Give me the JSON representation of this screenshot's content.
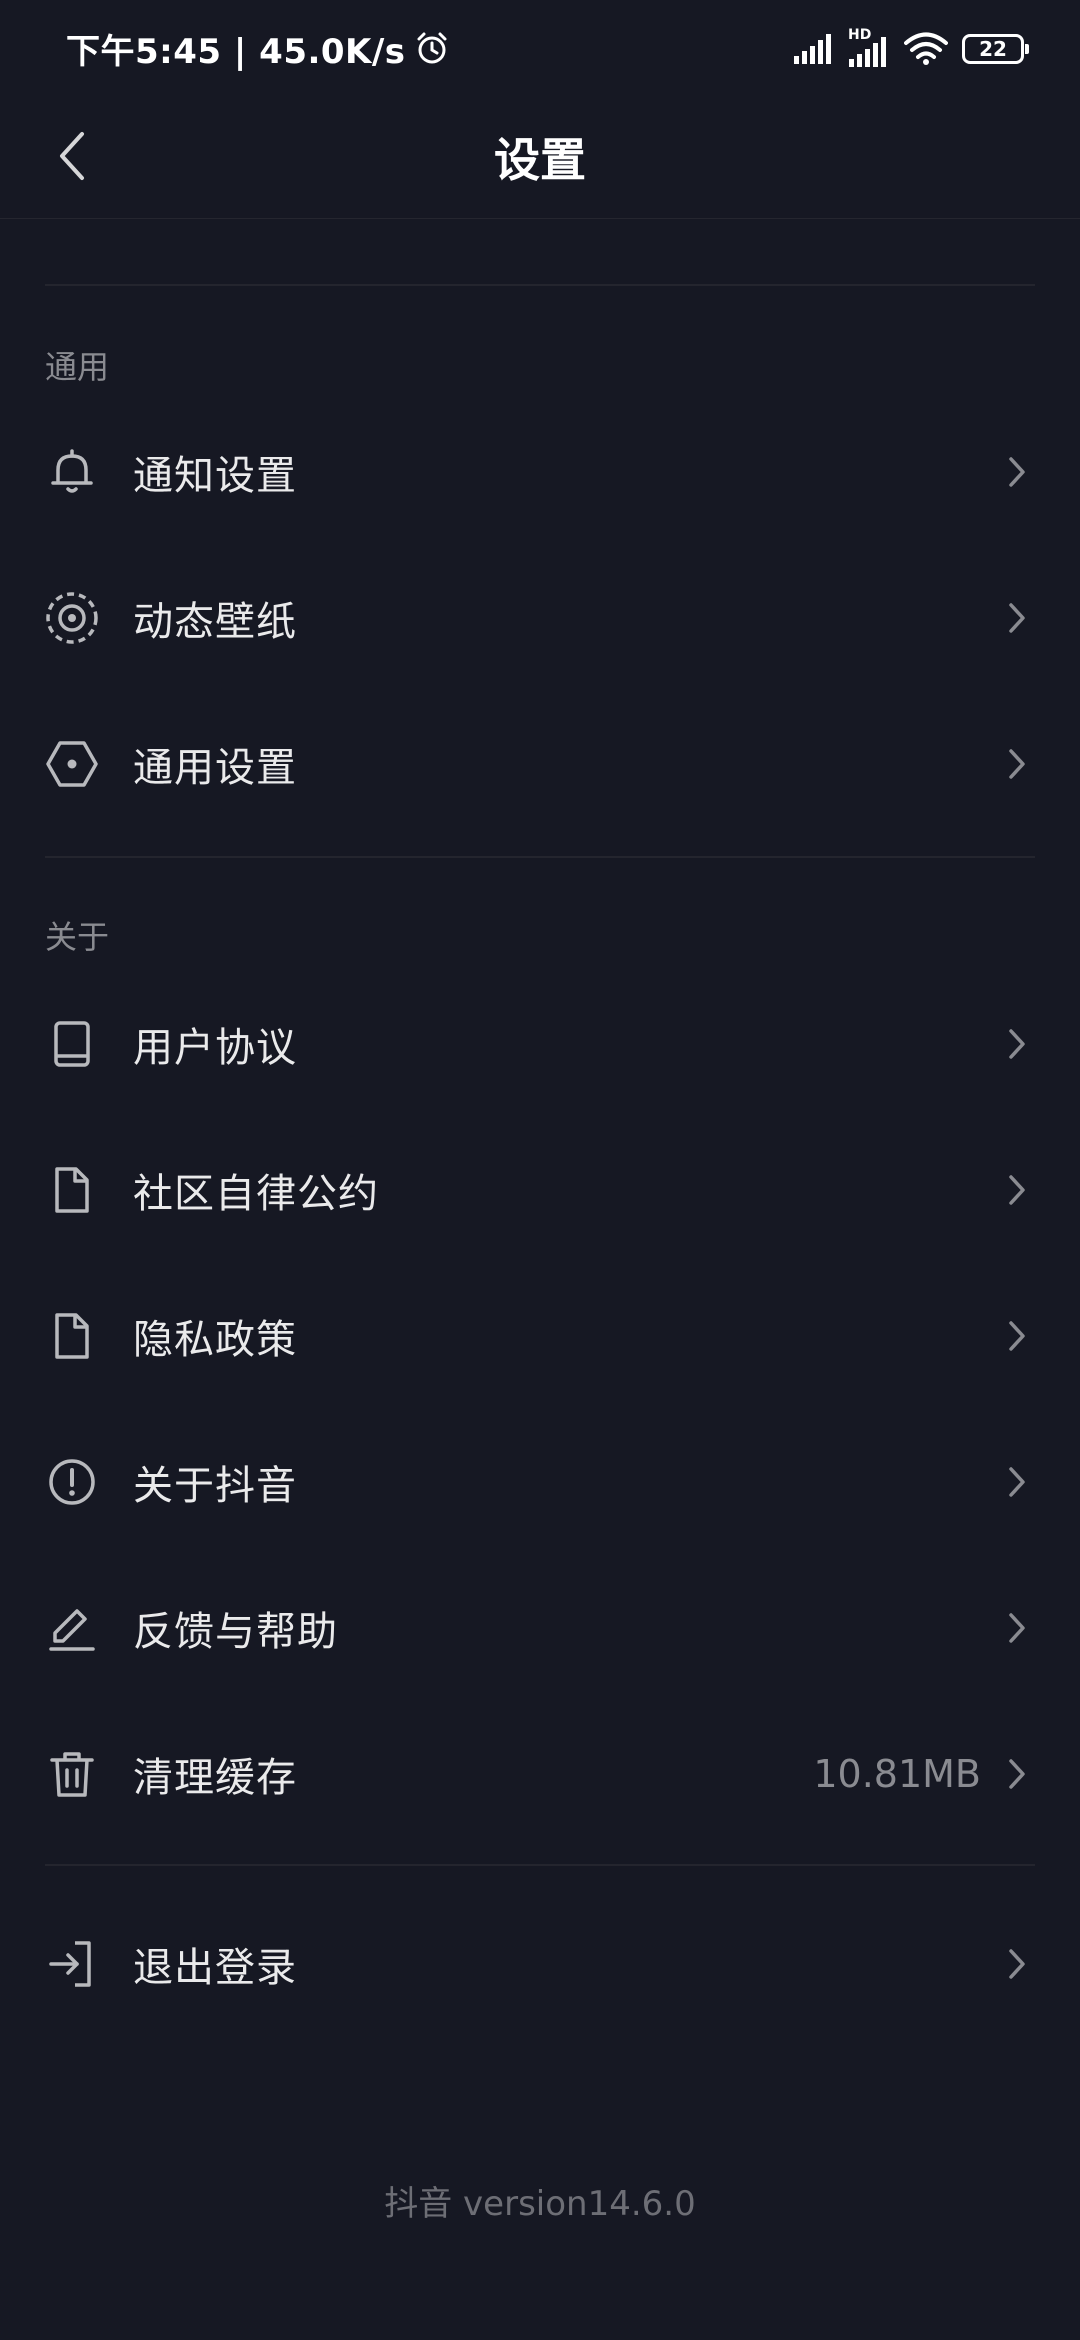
{
  "status_bar": {
    "time_speed": "下午5:45 | 45.0K/s",
    "hd_label": "HD",
    "battery": "22"
  },
  "header": {
    "title": "设置"
  },
  "sections": {
    "general": {
      "label": "通用",
      "items": [
        {
          "label": "通知设置",
          "icon": "bell-icon"
        },
        {
          "label": "动态壁纸",
          "icon": "dynamic-wallpaper-icon"
        },
        {
          "label": "通用设置",
          "icon": "hexagon-settings-icon"
        }
      ]
    },
    "about": {
      "label": "关于",
      "items": [
        {
          "label": "用户协议",
          "icon": "book-icon"
        },
        {
          "label": "社区自律公约",
          "icon": "document-icon"
        },
        {
          "label": "隐私政策",
          "icon": "document-icon"
        },
        {
          "label": "关于抖音",
          "icon": "info-circle-icon"
        },
        {
          "label": "反馈与帮助",
          "icon": "pencil-icon"
        },
        {
          "label": "清理缓存",
          "icon": "trash-icon",
          "value": "10.81MB"
        }
      ]
    },
    "logout": {
      "label": "退出登录",
      "icon": "logout-icon"
    }
  },
  "footer": {
    "version": "抖音 version14.6.0"
  },
  "colors": {
    "background": "#161823",
    "text_primary": "#eaeaeb",
    "text_secondary": "#8a8b91",
    "divider": "#24252e"
  }
}
